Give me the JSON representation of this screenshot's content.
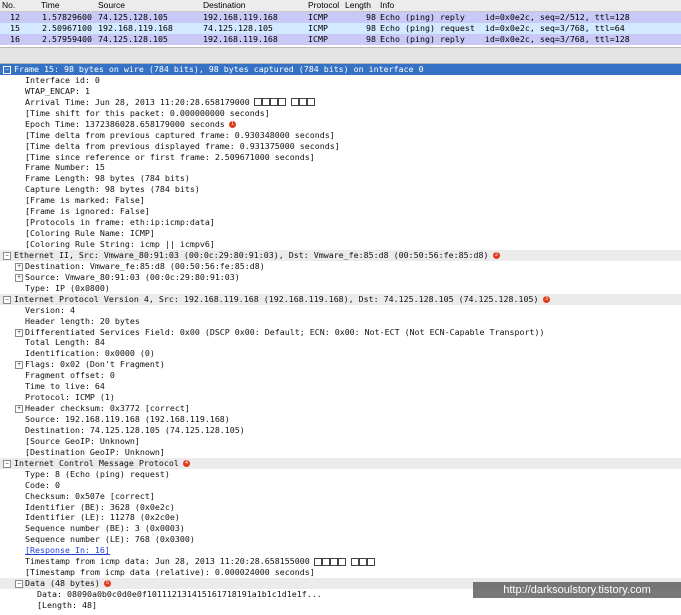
{
  "columns": [
    "No.",
    "Time",
    "Source",
    "Destination",
    "Protocol",
    "Length",
    "Info"
  ],
  "packets": [
    {
      "no": "12",
      "time": "1.57829600",
      "src": "74.125.128.105",
      "dst": "192.168.119.168",
      "proto": "ICMP",
      "len": "98",
      "info": "Echo (ping) reply    id=0x0e2c, seq=2/512, ttl=128"
    },
    {
      "no": "15",
      "time": "2.50967100",
      "src": "192.168.119.168",
      "dst": "74.125.128.105",
      "proto": "ICMP",
      "len": "98",
      "info": "Echo (ping) request  id=0x0e2c, seq=3/768, ttl=64"
    },
    {
      "no": "16",
      "time": "2.57959400",
      "src": "74.125.128.105",
      "dst": "192.168.119.168",
      "proto": "ICMP",
      "len": "98",
      "info": "Echo (ping) reply    id=0x0e2c, seq=3/768, ttl=128"
    }
  ],
  "tree": [
    {
      "t": "Frame 15: 98 bytes on wire (784 bits), 98 bytes captured (784 bits) on interface 0",
      "exp": "-",
      "cls": "sel",
      "ind": 0
    },
    {
      "t": "Interface id: 0",
      "ind": 1
    },
    {
      "t": "WTAP_ENCAP: 1",
      "ind": 1
    },
    {
      "t": "Arrival Time: Jun 28, 2013 11:20:28.658179000",
      "ind": 1,
      "boxes": [
        4,
        3
      ]
    },
    {
      "t": "[Time shift for this packet: 0.000000000 seconds]",
      "ind": 1
    },
    {
      "t": "Epoch Time: 1372386028.658179000 seconds",
      "ind": 1,
      "badge": "1"
    },
    {
      "t": "[Time delta from previous captured frame: 0.930348000 seconds]",
      "ind": 1
    },
    {
      "t": "[Time delta from previous displayed frame: 0.931375000 seconds]",
      "ind": 1
    },
    {
      "t": "[Time since reference or first frame: 2.509671000 seconds]",
      "ind": 1
    },
    {
      "t": "Frame Number: 15",
      "ind": 1
    },
    {
      "t": "Frame Length: 98 bytes (784 bits)",
      "ind": 1
    },
    {
      "t": "Capture Length: 98 bytes (784 bits)",
      "ind": 1
    },
    {
      "t": "[Frame is marked: False]",
      "ind": 1
    },
    {
      "t": "[Frame is ignored: False]",
      "ind": 1
    },
    {
      "t": "[Protocols in frame: eth:ip:icmp:data]",
      "ind": 1
    },
    {
      "t": "[Coloring Rule Name: ICMP]",
      "ind": 1
    },
    {
      "t": "[Coloring Rule String: icmp || icmpv6]",
      "ind": 1
    },
    {
      "t": "Ethernet II, Src: Vmware_80:91:03 (00:0c:29:80:91:03), Dst: Vmware_fe:85:d8 (00:50:56:fe:85:d8)",
      "exp": "-",
      "cls": "sec",
      "ind": 0,
      "badge": "2"
    },
    {
      "t": "Destination: Vmware_fe:85:d8 (00:50:56:fe:85:d8)",
      "exp": "+",
      "ind": 1
    },
    {
      "t": "Source: Vmware_80:91:03 (00:0c:29:80:91:03)",
      "exp": "+",
      "ind": 1
    },
    {
      "t": "Type: IP (0x0800)",
      "ind": 1
    },
    {
      "t": "Internet Protocol Version 4, Src: 192.168.119.168 (192.168.119.168), Dst: 74.125.128.105 (74.125.128.105)",
      "exp": "-",
      "cls": "sec",
      "ind": 0,
      "badge": "3"
    },
    {
      "t": "Version: 4",
      "ind": 1
    },
    {
      "t": "Header length: 20 bytes",
      "ind": 1
    },
    {
      "t": "Differentiated Services Field: 0x00 (DSCP 0x00: Default; ECN: 0x00: Not-ECT (Not ECN-Capable Transport))",
      "exp": "+",
      "ind": 1
    },
    {
      "t": "Total Length: 84",
      "ind": 1
    },
    {
      "t": "Identification: 0x0000 (0)",
      "ind": 1
    },
    {
      "t": "Flags: 0x02 (Don't Fragment)",
      "exp": "+",
      "ind": 1
    },
    {
      "t": "Fragment offset: 0",
      "ind": 1
    },
    {
      "t": "Time to live: 64",
      "ind": 1
    },
    {
      "t": "Protocol: ICMP (1)",
      "ind": 1
    },
    {
      "t": "Header checksum: 0x3772 [correct]",
      "exp": "+",
      "ind": 1
    },
    {
      "t": "Source: 192.168.119.168 (192.168.119.168)",
      "ind": 1
    },
    {
      "t": "Destination: 74.125.128.105 (74.125.128.105)",
      "ind": 1
    },
    {
      "t": "[Source GeoIP: Unknown]",
      "ind": 1
    },
    {
      "t": "[Destination GeoIP: Unknown]",
      "ind": 1
    },
    {
      "t": "Internet Control Message Protocol",
      "exp": "-",
      "cls": "sec",
      "ind": 0,
      "badge": "4"
    },
    {
      "t": "Type: 8 (Echo (ping) request)",
      "ind": 1
    },
    {
      "t": "Code: 0",
      "ind": 1
    },
    {
      "t": "Checksum: 0x507e [correct]",
      "ind": 1
    },
    {
      "t": "Identifier (BE): 3628 (0x0e2c)",
      "ind": 1
    },
    {
      "t": "Identifier (LE): 11278 (0x2c0e)",
      "ind": 1
    },
    {
      "t": "Sequence number (BE): 3 (0x0003)",
      "ind": 1
    },
    {
      "t": "Sequence number (LE): 768 (0x0300)",
      "ind": 1
    },
    {
      "t": "[Response In: 16]",
      "ind": 1,
      "link": true
    },
    {
      "t": "Timestamp from icmp data: Jun 28, 2013 11:20:28.658155000",
      "ind": 1,
      "boxes": [
        4,
        3
      ]
    },
    {
      "t": "[Timestamp from icmp data (relative): 0.000024000 seconds]",
      "ind": 1
    },
    {
      "t": "Data (48 bytes)",
      "exp": "-",
      "cls": "sec",
      "ind": 1,
      "badge": "5"
    },
    {
      "t": "Data: 08090a0b0c0d0e0f101112131415161718191a1b1c1d1e1f...",
      "ind": 2
    },
    {
      "t": "[Length: 48]",
      "ind": 2
    }
  ],
  "watermark": "http://darksoulstory.tistory.com",
  "colors": {
    "selected": "#3572c6",
    "reply_row": "#c9c9f7",
    "request_row": "#d3e9ff",
    "badge": "#e23a1c"
  }
}
